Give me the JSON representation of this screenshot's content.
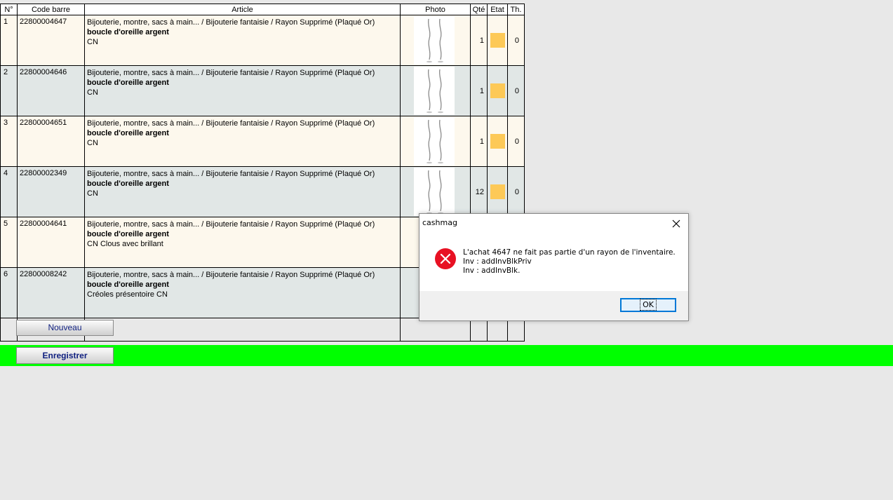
{
  "table": {
    "headers": {
      "num": "N°",
      "code": "Code barre",
      "article": "Article",
      "photo": "Photo",
      "qty": "Qté",
      "state": "Etat",
      "th": "Th."
    },
    "rows": [
      {
        "num": "1",
        "code": "22800004647",
        "category": "Bijouterie, montre, sacs à main... / Bijouterie fantaisie / Rayon Supprimé (Plaqué Or)",
        "name": "boucle d'oreille argent",
        "detail": "CN",
        "qty": "1",
        "th": "0"
      },
      {
        "num": "2",
        "code": "22800004646",
        "category": "Bijouterie, montre, sacs à main... / Bijouterie fantaisie / Rayon Supprimé (Plaqué Or)",
        "name": "boucle d'oreille argent",
        "detail": "CN",
        "qty": "1",
        "th": "0"
      },
      {
        "num": "3",
        "code": "22800004651",
        "category": "Bijouterie, montre, sacs à main... / Bijouterie fantaisie / Rayon Supprimé (Plaqué Or)",
        "name": "boucle d'oreille argent",
        "detail": "CN",
        "qty": "1",
        "th": "0"
      },
      {
        "num": "4",
        "code": "22800002349",
        "category": "Bijouterie, montre, sacs à main... / Bijouterie fantaisie / Rayon Supprimé (Plaqué Or)",
        "name": "boucle d'oreille argent",
        "detail": "CN",
        "qty": "12",
        "th": "0"
      },
      {
        "num": "5",
        "code": "22800004641",
        "category": "Bijouterie, montre, sacs à main... / Bijouterie fantaisie / Rayon Supprimé (Plaqué Or)",
        "name": "boucle d'oreille argent",
        "detail": "CN Clous avec brillant",
        "qty": "",
        "th": ""
      },
      {
        "num": "6",
        "code": "22800008242",
        "category": "Bijouterie, montre, sacs à main... / Bijouterie fantaisie / Rayon Supprimé (Plaqué Or)",
        "name": "boucle d'oreille argent",
        "detail": "Créoles présentoire CN",
        "qty": "",
        "th": ""
      }
    ]
  },
  "buttons": {
    "new": "Nouveau",
    "save": "Enregistrer"
  },
  "dialog": {
    "title": "cashmag",
    "lines": [
      "L'achat 4647 ne fait pas partie d'un rayon de l'inventaire.",
      "Inv : addInvBlkPriv",
      "Inv : addInvBlk."
    ],
    "ok_label": "OK",
    "icon": "error-icon"
  },
  "colors": {
    "state_swatch": "#fdc957",
    "save_bar": "#00ff00",
    "row_odd": "#fdf8ed",
    "row_even": "#e1e7e6"
  }
}
